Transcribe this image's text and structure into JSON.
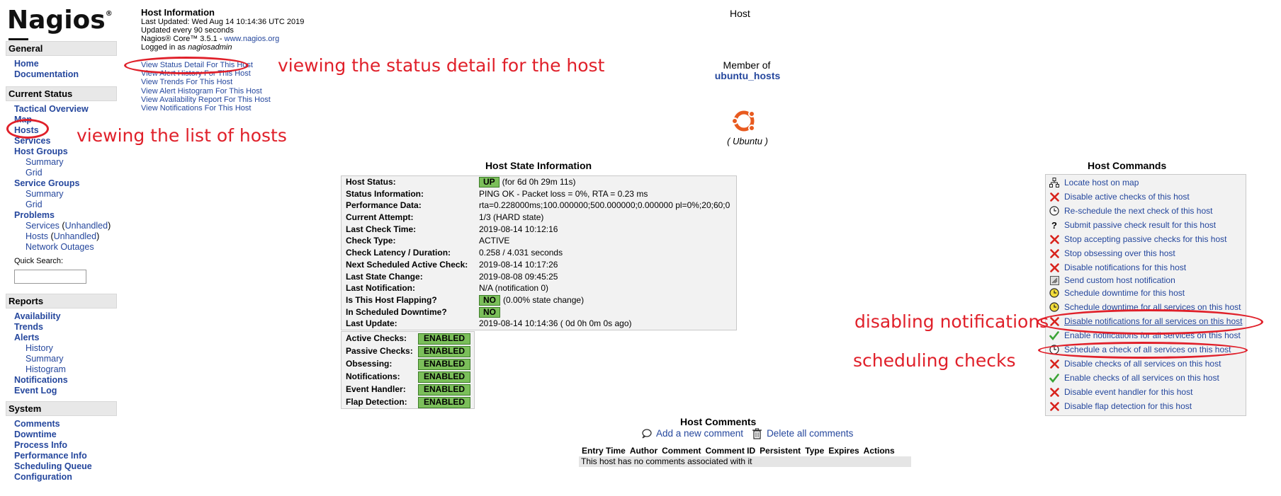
{
  "sidebar": {
    "logo": "Nagios",
    "logo_mark": "®",
    "general": {
      "header": "General",
      "items": [
        "Home",
        "Documentation"
      ]
    },
    "current_status": {
      "header": "Current Status",
      "tactical": "Tactical Overview",
      "map": "Map",
      "hosts": "Hosts",
      "services": "Services",
      "host_groups": "Host Groups",
      "hg_summary": "Summary",
      "hg_grid": "Grid",
      "service_groups": "Service Groups",
      "sg_summary": "Summary",
      "sg_grid": "Grid",
      "problems": "Problems",
      "p_services": "Services",
      "p_hosts": "Hosts",
      "unhandled": "Unhandled",
      "network_outages": "Network Outages",
      "quick_search": "Quick Search:"
    },
    "reports": {
      "header": "Reports",
      "availability": "Availability",
      "trends": "Trends",
      "alerts": "Alerts",
      "history": "History",
      "summary": "Summary",
      "histogram": "Histogram",
      "notifications": "Notifications",
      "event_log": "Event Log"
    },
    "system": {
      "header": "System",
      "items": [
        "Comments",
        "Downtime",
        "Process Info",
        "Performance Info",
        "Scheduling Queue",
        "Configuration"
      ]
    }
  },
  "info": {
    "title": "Host Information",
    "last_updated": "Last Updated: Wed Aug 14 10:14:36 UTC 2019",
    "updated_every": "Updated every 90 seconds",
    "version_prefix": "Nagios® Core™ 3.5.1 - ",
    "version_link": "www.nagios.org",
    "logged_in_prefix": "Logged in as ",
    "user": "nagiosadmin",
    "links": [
      "View Status Detail For This Host",
      "View Alert History For This Host",
      "View Trends For This Host",
      "View Alert Histogram For This Host",
      "View Availability Report For This Host",
      "View Notifications For This Host"
    ]
  },
  "annotations": {
    "status_detail": "viewing the status detail for the host",
    "hosts_list": "viewing the list of hosts",
    "disabling": "disabling notifications",
    "scheduling": "scheduling checks"
  },
  "host": {
    "page_title": "Host",
    "member_of": "Member of",
    "group": "ubuntu_hosts",
    "os_label": "( Ubuntu )"
  },
  "state": {
    "title": "Host State Information",
    "rows": [
      {
        "k": "Host Status:",
        "badge": "UP",
        "v": "(for 6d 0h 29m 11s)"
      },
      {
        "k": "Status Information:",
        "v": "PING OK - Packet loss = 0%, RTA = 0.23 ms"
      },
      {
        "k": "Performance Data:",
        "v": "rta=0.228000ms;100.000000;500.000000;0.000000 pl=0%;20;60;0"
      },
      {
        "k": "Current Attempt:",
        "v": "1/3  (HARD state)"
      },
      {
        "k": "Last Check Time:",
        "v": "2019-08-14 10:12:16"
      },
      {
        "k": "Check Type:",
        "v": "ACTIVE"
      },
      {
        "k": "Check Latency / Duration:",
        "v": "0.258 / 4.031 seconds"
      },
      {
        "k": "Next Scheduled Active Check:",
        "v": "2019-08-14 10:17:26"
      },
      {
        "k": "Last State Change:",
        "v": "2019-08-08 09:45:25"
      },
      {
        "k": "Last Notification:",
        "v": "N/A (notification 0)"
      },
      {
        "k": "Is This Host Flapping?",
        "badge": "NO",
        "v": "(0.00% state change)"
      },
      {
        "k": "In Scheduled Downtime?",
        "badge": "NO",
        "v": ""
      },
      {
        "k": "Last Update:",
        "v": "2019-08-14 10:14:36  ( 0d 0h 0m 0s ago)"
      }
    ],
    "checks": [
      {
        "k": "Active Checks:",
        "badge": "ENABLED"
      },
      {
        "k": "Passive Checks:",
        "badge": "ENABLED"
      },
      {
        "k": "Obsessing:",
        "badge": "ENABLED"
      },
      {
        "k": "Notifications:",
        "badge": "ENABLED"
      },
      {
        "k": "Event Handler:",
        "badge": "ENABLED"
      },
      {
        "k": "Flap Detection:",
        "badge": "ENABLED"
      }
    ]
  },
  "comments": {
    "title": "Host Comments",
    "add": "Add a new comment",
    "delete": "Delete all comments",
    "columns": [
      "Entry Time",
      "Author",
      "Comment",
      "Comment ID",
      "Persistent",
      "Type",
      "Expires",
      "Actions"
    ],
    "empty": "This host has no comments associated with it"
  },
  "commands": {
    "title": "Host Commands",
    "items": [
      {
        "icon": "map-icon",
        "label": "Locate host on map"
      },
      {
        "icon": "disable-icon",
        "label": "Disable active checks of this host"
      },
      {
        "icon": "clock-icon",
        "label": "Re-schedule the next check of this host"
      },
      {
        "icon": "question-icon",
        "label": "Submit passive check result for this host"
      },
      {
        "icon": "disable-icon",
        "label": "Stop accepting passive checks for this host"
      },
      {
        "icon": "disable-icon",
        "label": "Stop obsessing over this host"
      },
      {
        "icon": "disable-icon",
        "label": "Disable notifications for this host"
      },
      {
        "icon": "notify-icon",
        "label": "Send custom host notification"
      },
      {
        "icon": "downtime-icon",
        "label": "Schedule downtime for this host"
      },
      {
        "icon": "downtime-icon",
        "label": "Schedule downtime for all services on this host"
      },
      {
        "icon": "disable-icon",
        "label": "Disable notifications for all services on this host"
      },
      {
        "icon": "enable-icon",
        "label": "Enable notifications for all services on this host"
      },
      {
        "icon": "clock-icon",
        "label": "Schedule a check of all services on this host"
      },
      {
        "icon": "disable-icon",
        "label": "Disable checks of all services on this host"
      },
      {
        "icon": "enable-icon",
        "label": "Enable checks of all services on this host"
      },
      {
        "icon": "disable-icon",
        "label": "Disable event handler for this host"
      },
      {
        "icon": "disable-icon",
        "label": "Disable flap detection for this host"
      }
    ]
  },
  "colors": {
    "link": "#25479d",
    "badge": "#7bbf5a",
    "annotation": "#e0202a"
  }
}
